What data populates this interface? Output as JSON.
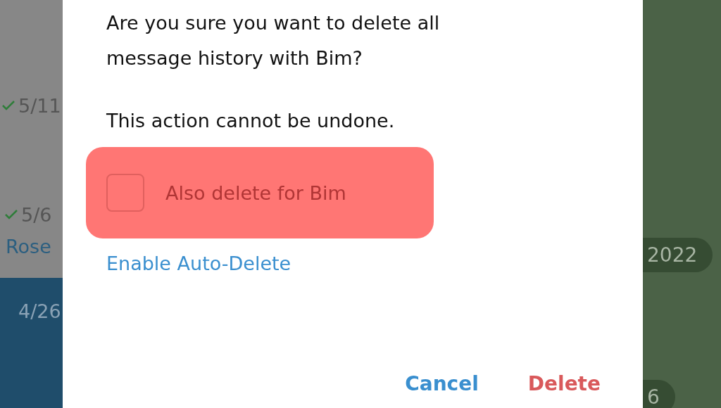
{
  "chat_list": {
    "items": [
      {
        "kind": "date",
        "date": "5/11",
        "read": true,
        "selected": false
      },
      {
        "kind": "date",
        "date": "5/6",
        "read": true,
        "selected": false
      },
      {
        "kind": "name",
        "name": "Rose",
        "selected": false
      },
      {
        "kind": "date",
        "date": "4/26",
        "read": false,
        "selected": true
      }
    ]
  },
  "dialog": {
    "message": "Are you sure you want to delete all message history with Bim?",
    "warning": "This action cannot be undone.",
    "option": {
      "label": "Also delete for Bim",
      "checked": false,
      "highlighted": true
    },
    "link": "Enable Auto-Delete",
    "buttons": [
      {
        "kind": "cancel",
        "label": "Cancel"
      },
      {
        "kind": "danger",
        "label": "Delete"
      }
    ]
  },
  "chat_area": {
    "badges": [
      "2022",
      "6"
    ]
  }
}
